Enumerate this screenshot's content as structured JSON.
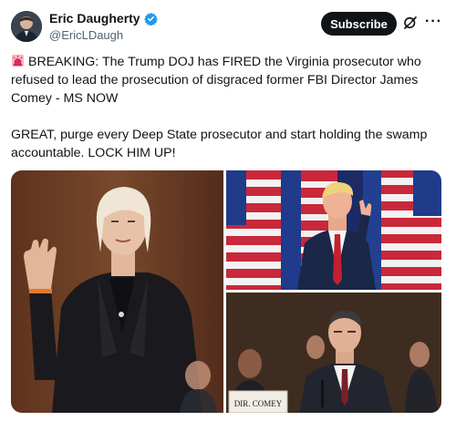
{
  "author": {
    "display_name": "Eric Daugherty",
    "handle": "@EricLDaugh",
    "verified": true
  },
  "actions": {
    "subscribe_label": "Subscribe",
    "grok_icon": "grok-icon",
    "more_icon": "more-options-icon",
    "more_glyph": "···"
  },
  "post": {
    "paragraph1": "BREAKING: The Trump DOJ has FIRED the Virginia prosecutor who refused to lead the prosecution of disgraced former FBI Director James Comey - MS NOW",
    "paragraph2": "GREAT, purge every Deep State prosecutor and start holding the swamp accountable. LOCK HIM UP!",
    "emoji": "police-siren-icon"
  },
  "media": {
    "images": [
      {
        "description_icon": "woman-raising-hand-photo"
      },
      {
        "description_icon": "man-pointing-flags-photo"
      },
      {
        "description_icon": "hearing-witness-photo",
        "placard_text": "DIR. COMEY"
      }
    ]
  },
  "colors": {
    "text": "#0f1419",
    "secondary": "#536471",
    "verified": "#1d9bf0",
    "button_bg": "#0f1419"
  }
}
